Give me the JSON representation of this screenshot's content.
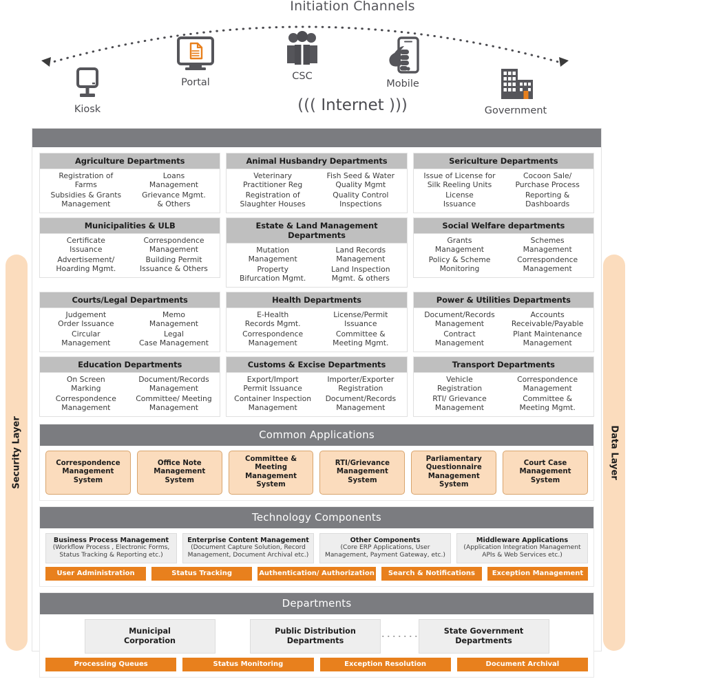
{
  "channels": {
    "title": "Initiation Channels",
    "internet_label": "Internet",
    "internet_wave_left": "((( ",
    "internet_wave_right": " )))",
    "items": [
      {
        "label": "Kiosk",
        "icon": "kiosk-icon"
      },
      {
        "label": "Portal",
        "icon": "portal-monitor-icon"
      },
      {
        "label": "CSC",
        "icon": "people-group-icon"
      },
      {
        "label": "Mobile",
        "icon": "mobile-hand-icon"
      },
      {
        "label": "Government",
        "icon": "government-building-icon"
      }
    ]
  },
  "side_layers": {
    "security": "Security Layer",
    "data": "Data Layer"
  },
  "departments_grid": [
    {
      "title": "Agriculture Departments",
      "services": [
        "Registration of\nFarms",
        "Loans\nManagement",
        "Subsidies & Grants\nManagement",
        "Grievance Mgmt.\n& Others"
      ]
    },
    {
      "title": "Animal Husbandry Departments",
      "services": [
        "Veterinary\nPractitioner Reg",
        "Fish Seed & Water\nQuality Mgmt",
        "Registration of\nSlaughter Houses",
        "Quality Control\nInspections"
      ]
    },
    {
      "title": "Sericulture Departments",
      "services": [
        "Issue of License for\nSilk Reeling Units",
        "Cocoon Sale/\nPurchase Process",
        "License\nIssuance",
        "Reporting &\nDashboards"
      ]
    },
    {
      "title": "Municipalities & ULB",
      "services": [
        "Certificate\nIssuance",
        "Correspondence\nManagement",
        "Advertisement/\nHoarding Mgmt.",
        "Building Permit\nIssuance & Others"
      ]
    },
    {
      "title": "Estate & Land Management Departments",
      "services": [
        "Mutation\nManagement",
        "Land Records\nManagement",
        "Property\nBifurcation Mgmt.",
        "Land Inspection\nMgmt. & others"
      ]
    },
    {
      "title": "Social Welfare departments",
      "services": [
        "Grants\nManagement",
        "Schemes\nManagement",
        "Policy & Scheme\nMonitoring",
        "Correspondence\nManagement"
      ]
    },
    {
      "title": "Courts/Legal Departments",
      "services": [
        "Judgement\nOrder Issuance",
        "Memo\nManagement",
        "Circular\nManagement",
        "Legal\nCase Management"
      ]
    },
    {
      "title": "Health Departments",
      "services": [
        "E-Health\nRecords Mgmt.",
        "License/Permit\nIssuance",
        "Correspondence\nManagement",
        "Committee &\nMeeting Mgmt."
      ]
    },
    {
      "title": "Power & Utilities Departments",
      "services": [
        "Document/Records\nManagement",
        "Accounts\nReceivable/Payable",
        "Contract\nManagement",
        "Plant Maintenance\nManagement"
      ]
    },
    {
      "title": "Education Departments",
      "services": [
        "On Screen\nMarking",
        "Document/Records\nManagement",
        "Correspondence\nManagement",
        "Committee/ Meeting\nManagement"
      ]
    },
    {
      "title": "Customs & Excise Departments",
      "services": [
        "Export/Import\nPermit Issuance",
        "Importer/Exporter\nRegistration",
        "Container Inspection\nManagement",
        "Document/Records\nManagement"
      ]
    },
    {
      "title": "Transport Departments",
      "services": [
        "Vehicle\nRegistration",
        "Correspondence\nManagement",
        "RTI/ Grievance\nManagement",
        "Committee &\nMeeting Mgmt."
      ]
    }
  ],
  "common_applications": {
    "title": "Common Applications",
    "apps": [
      "Correspondence\nManagement System",
      "Office Note\nManagement System",
      "Committee & Meeting\nManagement System",
      "RTI/Grievance\nManagement System",
      "Parliamentary\nQuestionnaire\nManagement System",
      "Court Case\nManagement System"
    ]
  },
  "technology_components": {
    "title": "Technology Components",
    "boxes": [
      {
        "title": "Business Process Management",
        "sub": "(Workflow Process , Electronic Forms,\nStatus Tracking & Reporting etc.)"
      },
      {
        "title": "Enterprise Content Management",
        "sub": "(Document Capture Solution, Record\nManagement, Document Archival etc.)"
      },
      {
        "title": "Other Components",
        "sub": "(Core ERP Applications, User\nManagement, Payment Gateway, etc.)"
      },
      {
        "title": "Middleware Applications",
        "sub": "(Application Integration Management\nAPIs & Web Services etc.)"
      }
    ],
    "strip": [
      "User Administration",
      "Status Tracking",
      "Authentication/ Authorization",
      "Search & Notifications",
      "Exception Management"
    ]
  },
  "departments_bottom": {
    "title": "Departments",
    "boxes": [
      "Municipal\nCorporation",
      "Public Distribution\nDepartments",
      "State Government\nDepartments"
    ],
    "strip": [
      "Processing Queues",
      "Status Monitoring",
      "Exception Resolution",
      "Document Archival"
    ]
  },
  "colors": {
    "gray_header": "#7b7c80",
    "dept_title_gray": "#bfbfbf",
    "orange": "#e8801d",
    "peach": "#fbdcbd",
    "peach_border": "#d8a46c",
    "icon_gray": "#55555a",
    "light_box": "#eeeeee"
  }
}
